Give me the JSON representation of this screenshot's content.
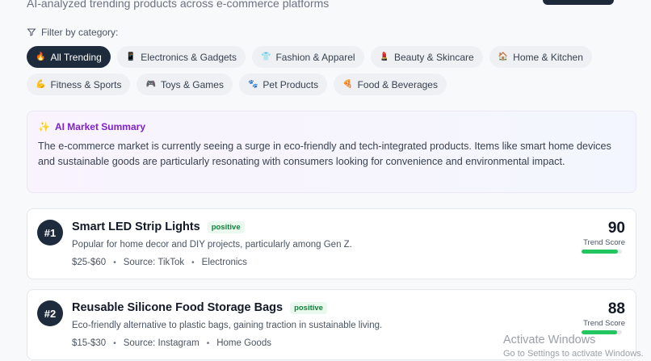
{
  "header": {
    "subtitle": "AI-analyzed trending products across e-commerce platforms"
  },
  "filter": {
    "label": "Filter by category:",
    "categories": [
      {
        "emoji": "🔥",
        "label": "All Trending",
        "active": true
      },
      {
        "emoji": "📱",
        "label": "Electronics & Gadgets"
      },
      {
        "emoji": "👕",
        "label": "Fashion & Apparel"
      },
      {
        "emoji": "💄",
        "label": "Beauty & Skincare"
      },
      {
        "emoji": "🏠",
        "label": "Home & Kitchen"
      },
      {
        "emoji": "💪",
        "label": "Fitness & Sports"
      },
      {
        "emoji": "🎮",
        "label": "Toys & Games"
      },
      {
        "emoji": "🐾",
        "label": "Pet Products"
      },
      {
        "emoji": "🍕",
        "label": "Food & Beverages"
      }
    ]
  },
  "summary": {
    "icon": "sparkles-icon",
    "title": "AI Market Summary",
    "text": "The e-commerce market is currently seeing a surge in eco-friendly and tech-integrated products. Items like smart home devices and sustainable goods are particularly resonating with consumers looking for convenience and environmental impact."
  },
  "products": [
    {
      "rank": "#1",
      "name": "Smart LED Strip Lights",
      "sentiment": "positive",
      "description": "Popular for home decor and DIY projects, particularly among Gen Z.",
      "price": "$25-$60",
      "source": "Source: TikTok",
      "category": "Electronics",
      "score": "90",
      "score_label": "Trend Score",
      "score_fraction": 0.9
    },
    {
      "rank": "#2",
      "name": "Reusable Silicone Food Storage Bags",
      "sentiment": "positive",
      "description": "Eco-friendly alternative to plastic bags, gaining traction in sustainable living.",
      "price": "$15-$30",
      "source": "Source: Instagram",
      "category": "Home Goods",
      "score": "88",
      "score_label": "Trend Score",
      "score_fraction": 0.88
    }
  ],
  "bullet": "•",
  "watermark": {
    "title": "Activate Windows",
    "subtitle": "Go to Settings to activate Windows."
  },
  "colors": {
    "accent_dark": "#1e2b3c",
    "summary_accent": "#7e22ce",
    "positive": "#15803d",
    "score_bar": "#22c55e"
  }
}
